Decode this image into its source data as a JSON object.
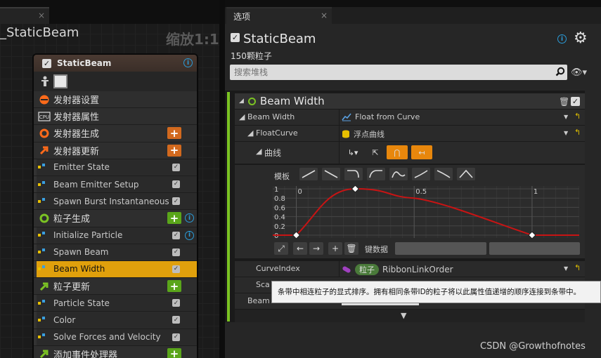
{
  "left": {
    "tab_close": "×",
    "graph_title": "_StaticBeam",
    "zoom_label": "缩放1:1",
    "node": {
      "title": "StaticBeam",
      "check": "✓",
      "info": "i",
      "rows": [
        {
          "label": "发射器设置",
          "kind": "section",
          "icon": "emitter-settings-icon",
          "color": "#ff6a1a"
        },
        {
          "label": "发射器属性",
          "kind": "section",
          "icon": "cpu-icon",
          "color": "#dddddd"
        },
        {
          "label": "发射器生成",
          "kind": "section",
          "icon": "spawn-ring-icon",
          "color": "#ff6a1a",
          "plus": "+",
          "plus_color": "#d2691e"
        },
        {
          "label": "发射器更新",
          "kind": "section",
          "icon": "update-arrow-icon",
          "color": "#ff6a1a",
          "plus": "+",
          "plus_color": "#d2691e"
        },
        {
          "label": "Emitter State",
          "kind": "item",
          "check": "✓"
        },
        {
          "label": "Beam Emitter Setup",
          "kind": "item",
          "check": "✓"
        },
        {
          "label": "Spawn Burst Instantaneous",
          "kind": "item",
          "check": "✓"
        },
        {
          "label": "粒子生成",
          "kind": "section",
          "icon": "spawn-ring-icon",
          "color": "#7bc323",
          "plus": "+",
          "plus_color": "#5aa51a",
          "info": "i"
        },
        {
          "label": "Initialize Particle",
          "kind": "item",
          "check": "✓",
          "info": "i"
        },
        {
          "label": "Spawn Beam",
          "kind": "item",
          "check": "✓"
        },
        {
          "label": "Beam Width",
          "kind": "selected",
          "check": "✓"
        },
        {
          "label": "粒子更新",
          "kind": "section",
          "icon": "update-arrow-icon",
          "color": "#7bc323",
          "plus": "+",
          "plus_color": "#5aa51a"
        },
        {
          "label": "Particle State",
          "kind": "item",
          "check": "✓"
        },
        {
          "label": "Color",
          "kind": "item",
          "check": "✓"
        },
        {
          "label": "Solve Forces and Velocity",
          "kind": "item",
          "check": "✓"
        },
        {
          "label": "添加事件处理器",
          "kind": "section",
          "icon": "event-handler-icon",
          "color": "#7bc323",
          "plus": "+",
          "plus_color": "#5aa51a"
        }
      ]
    }
  },
  "right": {
    "tab_label": "选项",
    "tab_close": "×",
    "emitter_name": "StaticBeam",
    "emitter_check": "✓",
    "info": "i",
    "particle_count": "150颗粒子",
    "search_placeholder": "搜索堆栈",
    "module": {
      "title": "Beam Width",
      "check": "✓",
      "props": [
        {
          "label": "Beam Width",
          "value": "Float from Curve"
        },
        {
          "label": "FloatCurve",
          "value": "浮点曲线"
        },
        {
          "label": "曲线",
          "value": ""
        }
      ],
      "template_label": "模板",
      "curve": {
        "x_ticks": [
          "0",
          "0.5",
          "1"
        ],
        "y_ticks": [
          "1",
          "0.8",
          "0.6",
          "0.4",
          "0.2",
          "0"
        ]
      },
      "key_data_label": "键数据",
      "curve_index_label": "CurveIndex",
      "curve_index_badge": "粒子",
      "curve_index_value": "RibbonLinkOrder",
      "scale_label_partial": "Sca",
      "beam_label_partial": "Beam"
    },
    "tooltip": "条带中相连粒子的显式排序。拥有相同条带ID的粒子将以此属性值递增的顺序连接到条带中。"
  },
  "watermark": "CSDN @Growthofnotes",
  "chart_data": {
    "type": "line",
    "x": [
      0,
      0.25,
      0.5,
      1
    ],
    "y": [
      0,
      1,
      0.8,
      0
    ],
    "xlim": [
      -0.1,
      1.2
    ],
    "ylim": [
      0,
      1
    ],
    "xticks": [
      "0",
      "0.5",
      "1"
    ],
    "yticks": [
      "0",
      "0.2",
      "0.4",
      "0.6",
      "0.8",
      "1"
    ],
    "line_color": "#c81414"
  }
}
